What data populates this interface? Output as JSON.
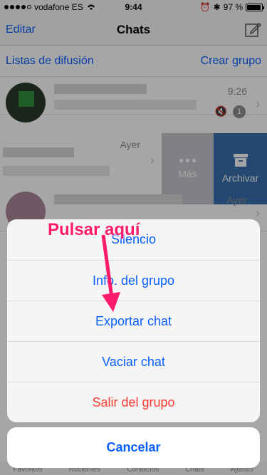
{
  "status": {
    "carrier": "vodafone ES",
    "time": "9:44",
    "battery": "97 %",
    "battery_fraction": 0.97
  },
  "nav": {
    "left": "Editar",
    "title": "Chats"
  },
  "broadcast": {
    "left": "Listas de difusión",
    "right": "Crear grupo"
  },
  "chats": [
    {
      "time": "9:26",
      "badge": "1"
    },
    {
      "time": "Ayer"
    },
    {
      "time": "Ayer"
    }
  ],
  "swipe_actions": {
    "more": "Más",
    "archive": "Archivar"
  },
  "sheet": {
    "items": [
      "Silencio",
      "Info. del grupo",
      "Exportar chat",
      "Vaciar chat",
      "Salir del grupo"
    ],
    "cancel": "Cancelar"
  },
  "annotation": {
    "text": "Pulsar aquí",
    "color": "#ff1a6b"
  },
  "tabs": [
    "Favoritos",
    "Recientes",
    "Contactos",
    "Chats",
    "Ajustes"
  ],
  "colors": {
    "accent": "#0a60ff",
    "destructive": "#ff3b30",
    "archive": "#3a6fb0"
  }
}
